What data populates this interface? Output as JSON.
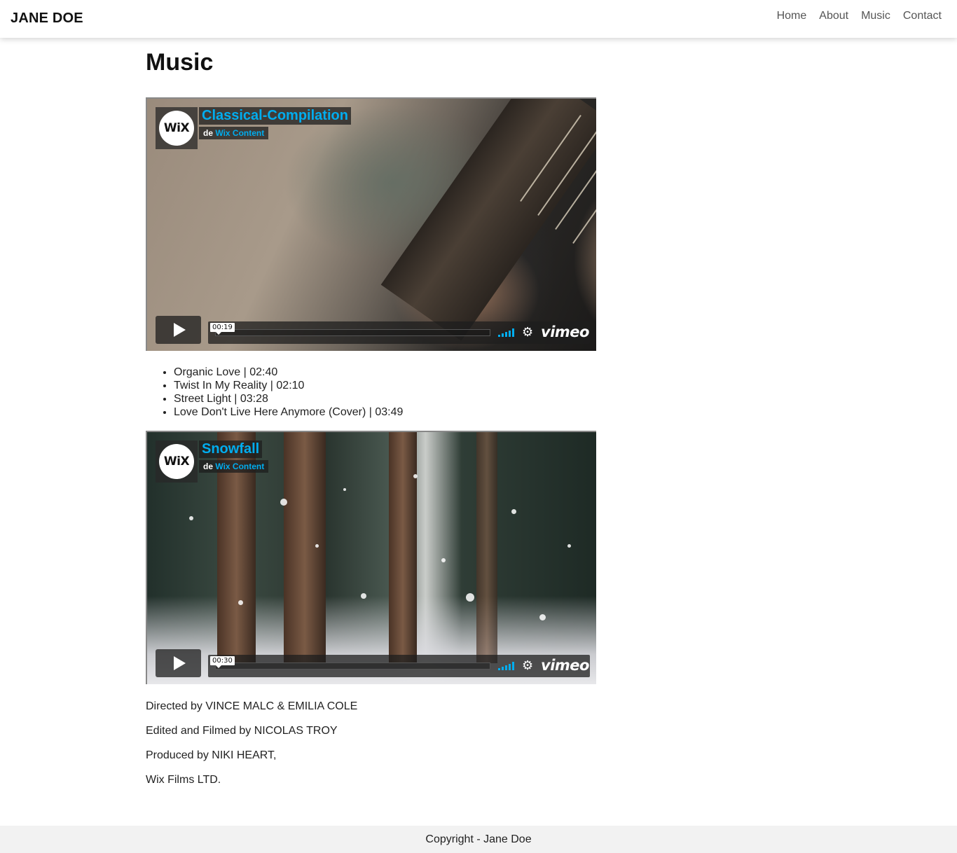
{
  "navbar": {
    "brand": "JANE DOE",
    "links": [
      "Home",
      "About",
      "Music",
      "Contact"
    ]
  },
  "page": {
    "title": "Music"
  },
  "videos": [
    {
      "title": "Classical-Compilation",
      "by_prefix": "de",
      "author": "Wix Content",
      "avatar_text": "WiX",
      "time": "00:19",
      "logo": "vimeo",
      "icons": [
        "play-icon",
        "volume-icon",
        "gear-icon"
      ]
    },
    {
      "title": "Snowfall",
      "by_prefix": "de",
      "author": "Wix Content",
      "avatar_text": "WiX",
      "time": "00:30",
      "logo": "vimeo",
      "icons": [
        "play-icon",
        "volume-icon",
        "gear-icon"
      ]
    }
  ],
  "tracks": [
    "Organic Love | 02:40",
    "Twist In My Reality | 02:10",
    "Street Light | 03:28",
    "Love Don't Live Here Anymore (Cover) | 03:49"
  ],
  "credits": [
    "Directed by VINCE MALC & EMILIA COLE",
    "Edited and Filmed by NICOLAS TROY",
    "Produced by NIKI HEART,",
    "Wix Films LTD."
  ],
  "footer": {
    "text": "Copyright - Jane Doe"
  },
  "colors": {
    "vimeo_accent": "#00adef",
    "footer_bg": "#f2f2f2"
  }
}
